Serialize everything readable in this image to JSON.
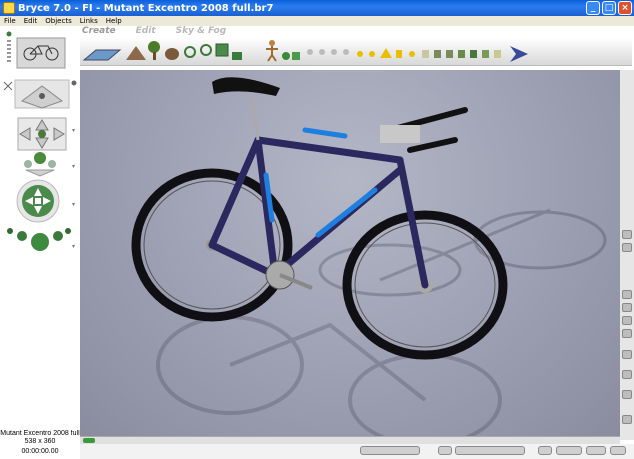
{
  "window": {
    "title": "Bryce 7.0 - FI - Mutant Excentro 2008 full.br7",
    "minimize": "_",
    "maximize": "□",
    "close": "×"
  },
  "menu": [
    "File",
    "Edit",
    "Objects",
    "Links",
    "Help"
  ],
  "tabs": {
    "create": "Create",
    "edit": "Edit",
    "sky_fog": "Sky & Fog"
  },
  "status": {
    "name": "Mutant Excentro 2008 full",
    "resolution": "538 x 360",
    "time": "00:00:00.00"
  },
  "colors": {
    "titlebar": "#1a5fd0",
    "viewport_bg": "#9a9db0",
    "bike_frame": "#2b2860",
    "bike_accent": "#1d7fe0"
  },
  "toolbar_icons": [
    "water-plane-icon",
    "terrain-icon",
    "tree-icon",
    "rock-icon",
    "torus-icon",
    "cube-icon",
    "person-icon",
    "sphere-icon",
    "primitive-icon",
    "light-icon",
    "camera-icon"
  ]
}
